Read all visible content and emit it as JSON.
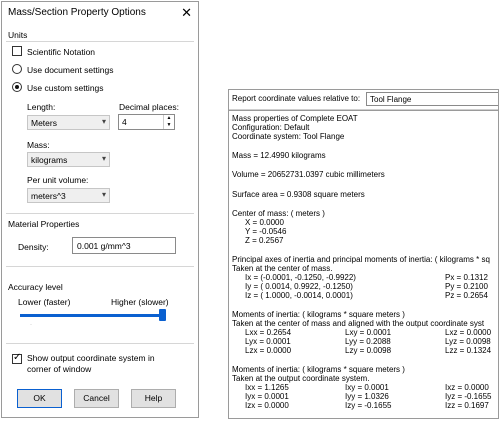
{
  "dialog": {
    "title": "Mass/Section Property Options",
    "close_glyph": "✕",
    "units_group": "Units",
    "scientific_notation": "Scientific Notation",
    "use_document_settings": "Use document settings",
    "use_custom_settings": "Use custom settings",
    "length_label": "Length:",
    "length_value": "Meters",
    "decimal_places_label": "Decimal places:",
    "decimal_places_value": "4",
    "mass_label": "Mass:",
    "mass_value": "kilograms",
    "per_unit_volume_label": "Per unit volume:",
    "per_unit_volume_value": "meters^3",
    "material_group": "Material Properties",
    "density_label": "Density:",
    "density_value": "0.001 g/mm^3",
    "accuracy_group": "Accuracy level",
    "lower_label": "Lower (faster)",
    "higher_label": "Higher (slower)",
    "accuracy_level": 0.97,
    "show_coord_line1": "Show output coordinate system in",
    "show_coord_line2": "corner of window",
    "ok": "OK",
    "cancel": "Cancel",
    "help": "Help"
  },
  "report": {
    "relative_label": "Report coordinate values relative to:",
    "relative_value": "Tool Flange",
    "lines": [
      "Mass properties of Complete EOAT",
      "     Configuration: Default",
      "     Coordinate system: Tool Flange",
      "Mass = 12.4990 kilograms",
      "Volume = 20652731.0397 cubic millimeters",
      "Surface area = 0.9308 square meters",
      "Center of mass: ( meters )",
      "X = 0.0000",
      "Y = -0.0546",
      "Z = 0.2567",
      "Principal axes of inertia and principal moments of inertia: ( kilograms * sq",
      "Taken at the center of mass.",
      "Ix = (-0.0001, -0.1250, -0.9922)",
      "Px = 0.1312",
      "Iy = ( 0.0014,  0.9922, -0.1250)",
      "Py = 0.2100",
      "Iz = ( 1.0000, -0.0014,  0.0001)",
      "Pz = 0.2654",
      "Moments of inertia: ( kilograms * square meters )",
      "Taken at the center of mass and aligned with the output coordinate syst",
      "Lxx = 0.2654",
      "Lxy = 0.0001",
      "Lxz = 0.0000",
      "Lyx = 0.0001",
      "Lyy = 0.2088",
      "Lyz = 0.0098",
      "Lzx = 0.0000",
      "Lzy = 0.0098",
      "Lzz = 0.1324",
      "Moments of inertia: ( kilograms * square meters )",
      "Taken at the output coordinate system.",
      "Ixx = 1.1265",
      "Ixy = 0.0001",
      "Ixz = 0.0000",
      "Iyx = 0.0001",
      "Iyy = 1.0326",
      "Iyz = -0.1655",
      "Izx = 0.0000",
      "Izy = -0.1655",
      "Izz = 0.1697"
    ]
  }
}
